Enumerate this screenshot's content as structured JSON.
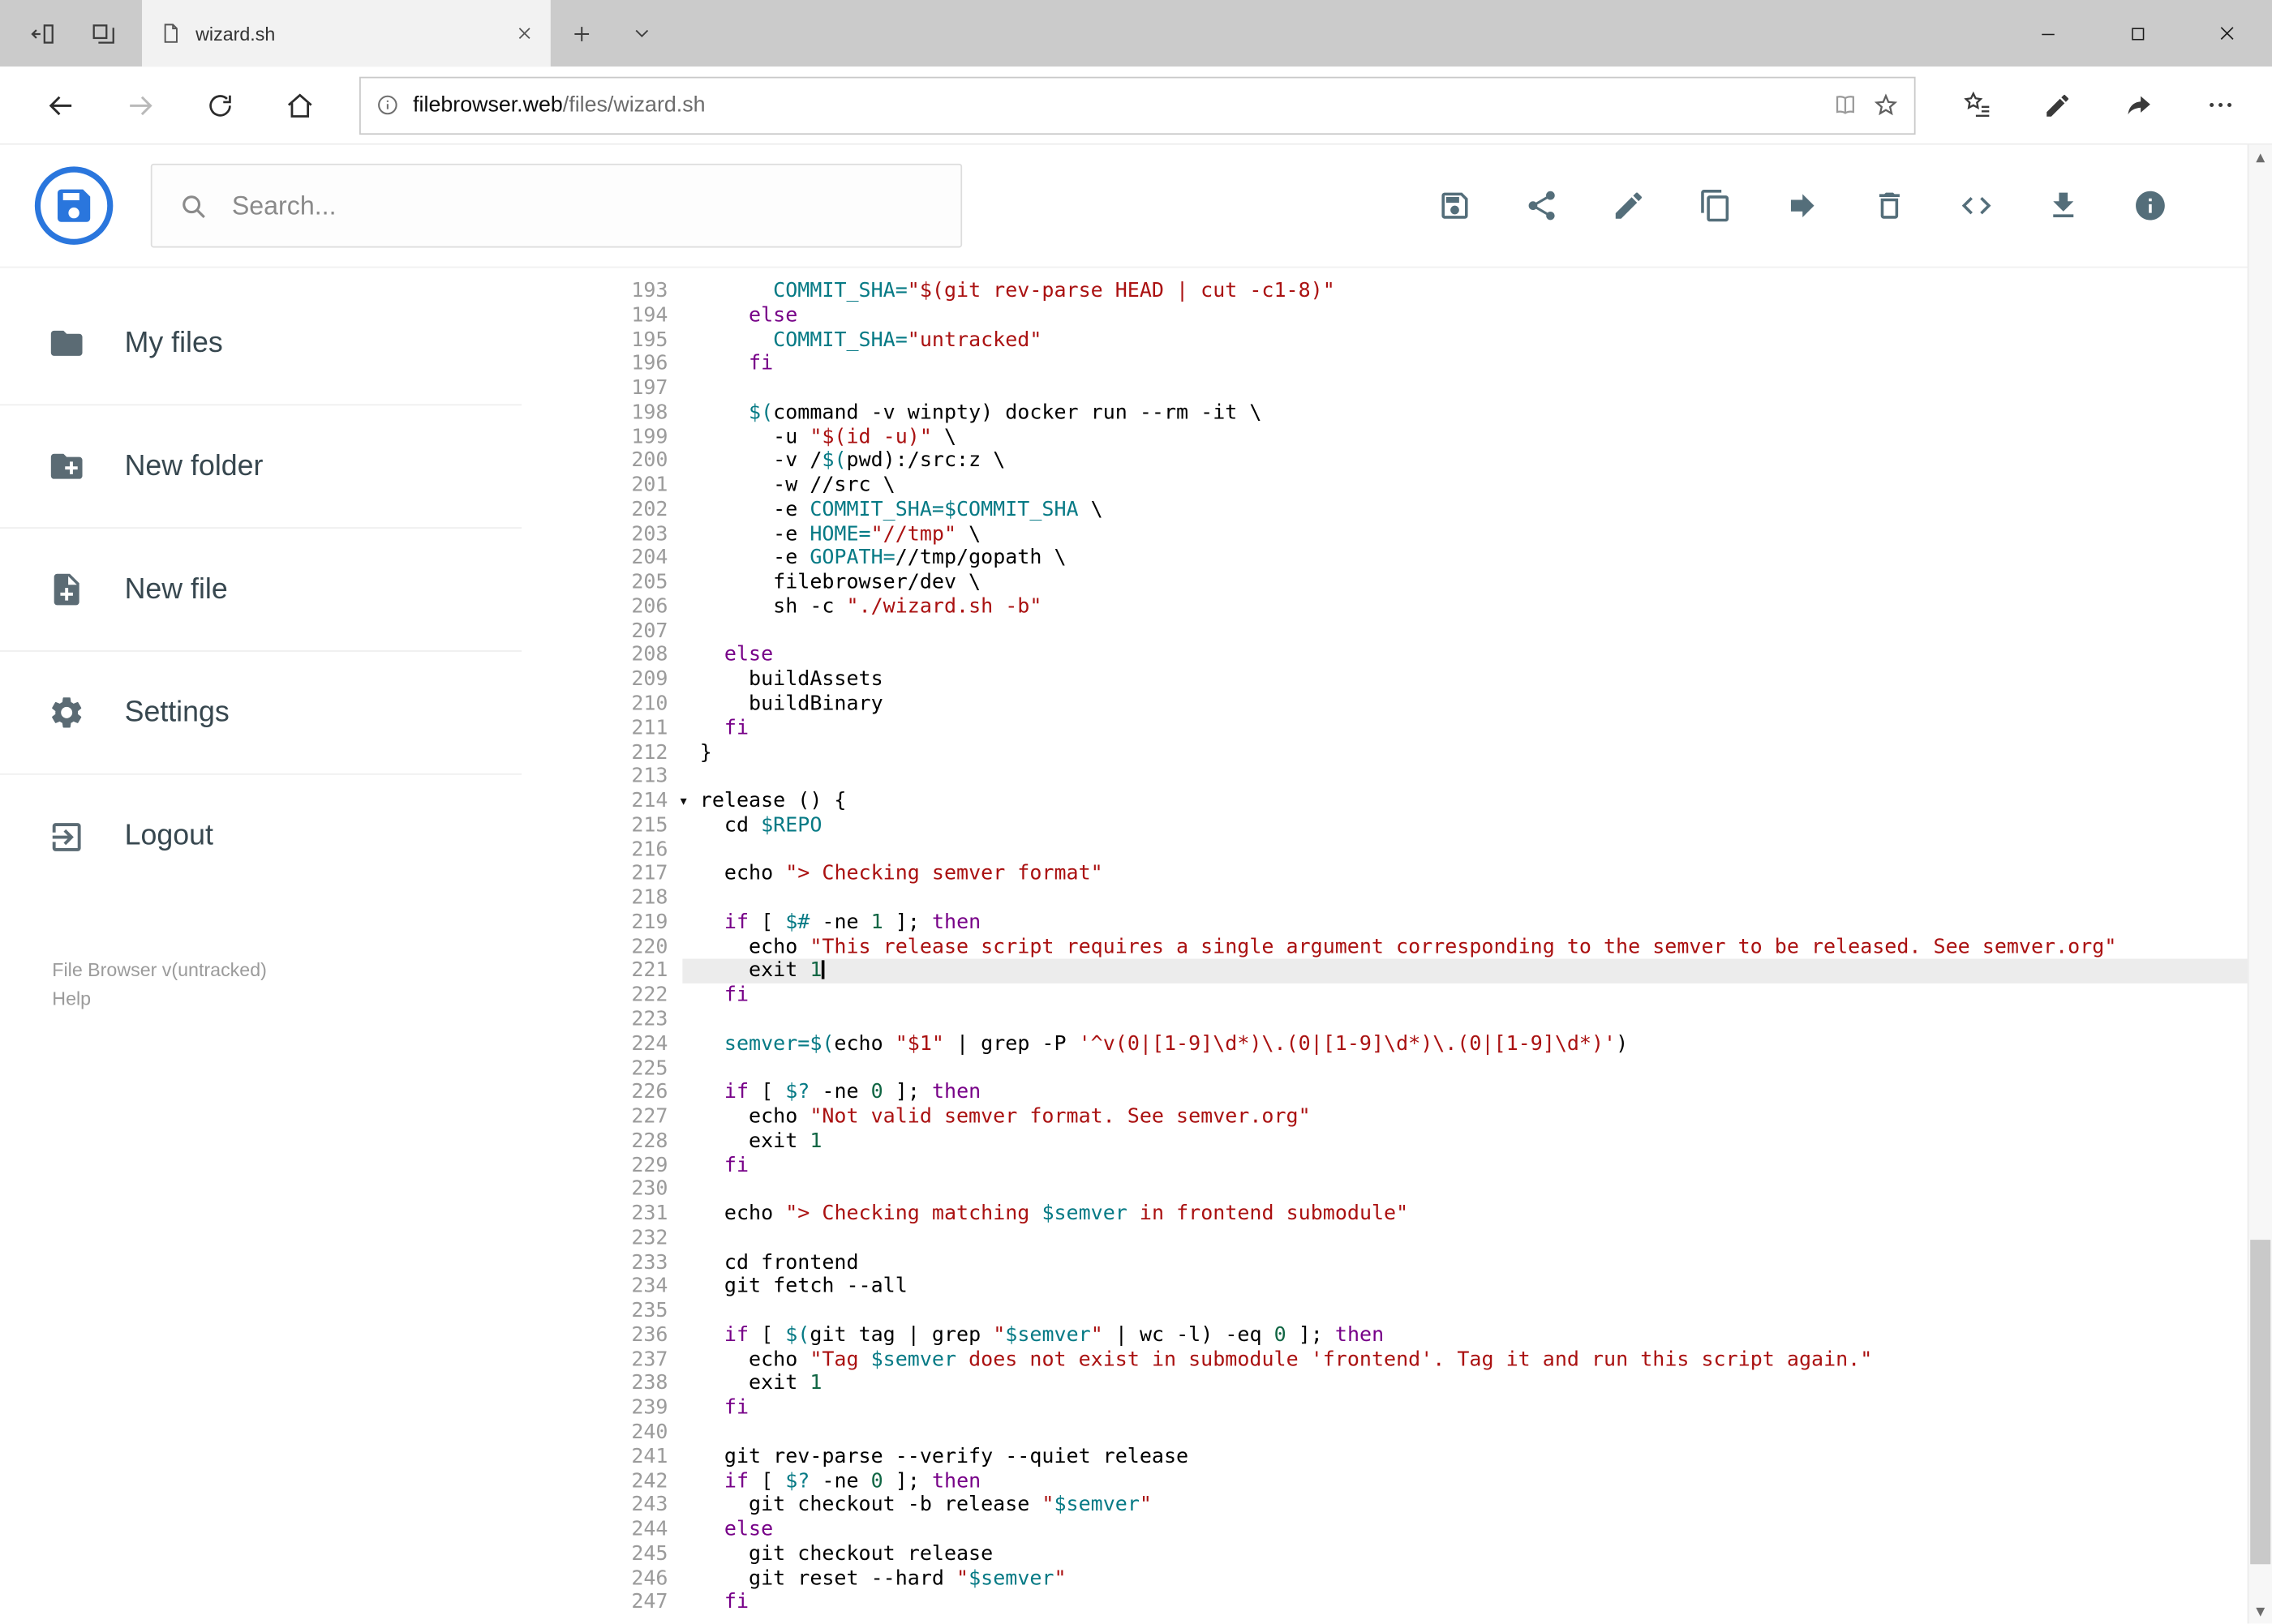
{
  "colors": {
    "brand": "#2a76dd",
    "icon": "#546e7a",
    "kw": "#770088",
    "str": "#aa1111",
    "var": "#067a85",
    "num": "#116644",
    "activebg": "#ececec"
  },
  "browser": {
    "tab_title": "wizard.sh",
    "url_domain": "filebrowser.web",
    "url_path": "/files/wizard.sh"
  },
  "header": {
    "search_placeholder": "Search...",
    "actions": [
      {
        "name": "save-button",
        "icon": "save-icon"
      },
      {
        "name": "share-button",
        "icon": "share-icon"
      },
      {
        "name": "edit-button",
        "icon": "edit-icon"
      },
      {
        "name": "copy-button",
        "icon": "copy-icon"
      },
      {
        "name": "move-button",
        "icon": "move-icon"
      },
      {
        "name": "delete-button",
        "icon": "delete-icon"
      },
      {
        "name": "code-button",
        "icon": "code-icon"
      },
      {
        "name": "download-button",
        "icon": "download-icon"
      },
      {
        "name": "info-button",
        "icon": "info-icon"
      }
    ]
  },
  "sidebar": {
    "items": [
      {
        "name": "sidebar-item-my-files",
        "icon": "folder-icon",
        "label": "My files"
      },
      {
        "name": "sidebar-item-new-folder",
        "icon": "new-folder-icon",
        "label": "New folder"
      },
      {
        "name": "sidebar-item-new-file",
        "icon": "new-file-icon",
        "label": "New file"
      },
      {
        "name": "sidebar-item-settings",
        "icon": "settings-icon",
        "label": "Settings"
      },
      {
        "name": "sidebar-item-logout",
        "icon": "logout-icon",
        "label": "Logout"
      }
    ],
    "footer": [
      "File Browser v(untracked)",
      "Help"
    ]
  },
  "editor": {
    "active_line": 221,
    "lines": [
      {
        "num": 193,
        "t": [
          [
            "p",
            "      "
          ],
          [
            "v",
            "COMMIT_SHA="
          ],
          [
            "s",
            "\"$(git rev-parse HEAD | cut -c1-8)\""
          ]
        ]
      },
      {
        "num": 194,
        "t": [
          [
            "p",
            "    "
          ],
          [
            "k",
            "else"
          ]
        ]
      },
      {
        "num": 195,
        "t": [
          [
            "p",
            "      "
          ],
          [
            "v",
            "COMMIT_SHA="
          ],
          [
            "s",
            "\"untracked\""
          ]
        ]
      },
      {
        "num": 196,
        "t": [
          [
            "p",
            "    "
          ],
          [
            "k",
            "fi"
          ]
        ]
      },
      {
        "num": 197,
        "t": []
      },
      {
        "num": 198,
        "t": [
          [
            "p",
            "    "
          ],
          [
            "v",
            "$("
          ],
          [
            "p",
            "command -v winpty) docker run --rm -it \\"
          ]
        ]
      },
      {
        "num": 199,
        "t": [
          [
            "p",
            "      -u "
          ],
          [
            "s",
            "\"$(id -u)\""
          ],
          [
            "p",
            " \\"
          ]
        ]
      },
      {
        "num": 200,
        "t": [
          [
            "p",
            "      -v /"
          ],
          [
            "v",
            "$("
          ],
          [
            "p",
            "pwd):/src:z \\"
          ]
        ]
      },
      {
        "num": 201,
        "t": [
          [
            "p",
            "      -w //src \\"
          ]
        ]
      },
      {
        "num": 202,
        "t": [
          [
            "p",
            "      -e "
          ],
          [
            "v",
            "COMMIT_SHA=$COMMIT_SHA"
          ],
          [
            "p",
            " \\"
          ]
        ]
      },
      {
        "num": 203,
        "t": [
          [
            "p",
            "      -e "
          ],
          [
            "v",
            "HOME="
          ],
          [
            "s",
            "\"//tmp\""
          ],
          [
            "p",
            " \\"
          ]
        ]
      },
      {
        "num": 204,
        "t": [
          [
            "p",
            "      -e "
          ],
          [
            "v",
            "GOPATH="
          ],
          [
            "p",
            "//tmp/gopath \\"
          ]
        ]
      },
      {
        "num": 205,
        "t": [
          [
            "p",
            "      filebrowser/dev \\"
          ]
        ]
      },
      {
        "num": 206,
        "t": [
          [
            "p",
            "      sh -c "
          ],
          [
            "s",
            "\"./wizard.sh -b\""
          ]
        ]
      },
      {
        "num": 207,
        "t": []
      },
      {
        "num": 208,
        "t": [
          [
            "p",
            "  "
          ],
          [
            "k",
            "else"
          ]
        ]
      },
      {
        "num": 209,
        "t": [
          [
            "p",
            "    buildAssets"
          ]
        ]
      },
      {
        "num": 210,
        "t": [
          [
            "p",
            "    buildBinary"
          ]
        ]
      },
      {
        "num": 211,
        "t": [
          [
            "p",
            "  "
          ],
          [
            "k",
            "fi"
          ]
        ]
      },
      {
        "num": 212,
        "t": [
          [
            "p",
            "}"
          ]
        ]
      },
      {
        "num": 213,
        "t": []
      },
      {
        "num": 214,
        "fold": true,
        "t": [
          [
            "p",
            "release () {"
          ]
        ]
      },
      {
        "num": 215,
        "t": [
          [
            "p",
            "  cd "
          ],
          [
            "v",
            "$REPO"
          ]
        ]
      },
      {
        "num": 216,
        "t": []
      },
      {
        "num": 217,
        "t": [
          [
            "p",
            "  echo "
          ],
          [
            "s",
            "\"> Checking semver format\""
          ]
        ]
      },
      {
        "num": 218,
        "t": []
      },
      {
        "num": 219,
        "t": [
          [
            "p",
            "  "
          ],
          [
            "k",
            "if"
          ],
          [
            "p",
            " [ "
          ],
          [
            "v",
            "$#"
          ],
          [
            "p",
            " -ne "
          ],
          [
            "d",
            "1"
          ],
          [
            "p",
            " ]; "
          ],
          [
            "k",
            "then"
          ]
        ]
      },
      {
        "num": 220,
        "t": [
          [
            "p",
            "    echo "
          ],
          [
            "s",
            "\"This release script requires a single argument corresponding to the semver to be released. See semver.org\""
          ]
        ]
      },
      {
        "num": 221,
        "active": true,
        "cursor": true,
        "t": [
          [
            "p",
            "    exit "
          ],
          [
            "d",
            "1"
          ]
        ]
      },
      {
        "num": 222,
        "t": [
          [
            "p",
            "  "
          ],
          [
            "k",
            "fi"
          ]
        ]
      },
      {
        "num": 223,
        "t": []
      },
      {
        "num": 224,
        "t": [
          [
            "p",
            "  "
          ],
          [
            "v",
            "semver=$("
          ],
          [
            "p",
            "echo "
          ],
          [
            "s",
            "\"$1\""
          ],
          [
            "p",
            " | grep -P "
          ],
          [
            "s",
            "'^v(0|[1-9]\\d*)\\.(0|[1-9]\\d*)\\.(0|[1-9]\\d*)'"
          ],
          [
            "p",
            ")"
          ]
        ]
      },
      {
        "num": 225,
        "t": []
      },
      {
        "num": 226,
        "t": [
          [
            "p",
            "  "
          ],
          [
            "k",
            "if"
          ],
          [
            "p",
            " [ "
          ],
          [
            "v",
            "$?"
          ],
          [
            "p",
            " -ne "
          ],
          [
            "d",
            "0"
          ],
          [
            "p",
            " ]; "
          ],
          [
            "k",
            "then"
          ]
        ]
      },
      {
        "num": 227,
        "t": [
          [
            "p",
            "    echo "
          ],
          [
            "s",
            "\"Not valid semver format. See semver.org\""
          ]
        ]
      },
      {
        "num": 228,
        "t": [
          [
            "p",
            "    exit "
          ],
          [
            "d",
            "1"
          ]
        ]
      },
      {
        "num": 229,
        "t": [
          [
            "p",
            "  "
          ],
          [
            "k",
            "fi"
          ]
        ]
      },
      {
        "num": 230,
        "t": []
      },
      {
        "num": 231,
        "t": [
          [
            "p",
            "  echo "
          ],
          [
            "s",
            "\"> Checking matching "
          ],
          [
            "v",
            "$semver"
          ],
          [
            "s",
            " in frontend submodule\""
          ]
        ]
      },
      {
        "num": 232,
        "t": []
      },
      {
        "num": 233,
        "t": [
          [
            "p",
            "  cd frontend"
          ]
        ]
      },
      {
        "num": 234,
        "t": [
          [
            "p",
            "  git fetch --all"
          ]
        ]
      },
      {
        "num": 235,
        "t": []
      },
      {
        "num": 236,
        "t": [
          [
            "p",
            "  "
          ],
          [
            "k",
            "if"
          ],
          [
            "p",
            " [ "
          ],
          [
            "v",
            "$("
          ],
          [
            "p",
            "git tag | grep "
          ],
          [
            "s",
            "\""
          ],
          [
            "v",
            "$semver"
          ],
          [
            "s",
            "\""
          ],
          [
            "p",
            " | wc -l) -eq "
          ],
          [
            "d",
            "0"
          ],
          [
            "p",
            " ]; "
          ],
          [
            "k",
            "then"
          ]
        ]
      },
      {
        "num": 237,
        "t": [
          [
            "p",
            "    echo "
          ],
          [
            "s",
            "\"Tag "
          ],
          [
            "v",
            "$semver"
          ],
          [
            "s",
            " does not exist in submodule 'frontend'. Tag it and run this script again.\""
          ]
        ]
      },
      {
        "num": 238,
        "t": [
          [
            "p",
            "    exit "
          ],
          [
            "d",
            "1"
          ]
        ]
      },
      {
        "num": 239,
        "t": [
          [
            "p",
            "  "
          ],
          [
            "k",
            "fi"
          ]
        ]
      },
      {
        "num": 240,
        "t": []
      },
      {
        "num": 241,
        "t": [
          [
            "p",
            "  git rev-parse --verify --quiet release"
          ]
        ]
      },
      {
        "num": 242,
        "t": [
          [
            "p",
            "  "
          ],
          [
            "k",
            "if"
          ],
          [
            "p",
            " [ "
          ],
          [
            "v",
            "$?"
          ],
          [
            "p",
            " -ne "
          ],
          [
            "d",
            "0"
          ],
          [
            "p",
            " ]; "
          ],
          [
            "k",
            "then"
          ]
        ]
      },
      {
        "num": 243,
        "t": [
          [
            "p",
            "    git checkout -b release "
          ],
          [
            "s",
            "\""
          ],
          [
            "v",
            "$semver"
          ],
          [
            "s",
            "\""
          ]
        ]
      },
      {
        "num": 244,
        "t": [
          [
            "p",
            "  "
          ],
          [
            "k",
            "else"
          ]
        ]
      },
      {
        "num": 245,
        "t": [
          [
            "p",
            "    git checkout release"
          ]
        ]
      },
      {
        "num": 246,
        "t": [
          [
            "p",
            "    git reset --hard "
          ],
          [
            "s",
            "\""
          ],
          [
            "v",
            "$semver"
          ],
          [
            "s",
            "\""
          ]
        ]
      },
      {
        "num": 247,
        "t": [
          [
            "p",
            "  "
          ],
          [
            "k",
            "fi"
          ]
        ]
      }
    ]
  }
}
